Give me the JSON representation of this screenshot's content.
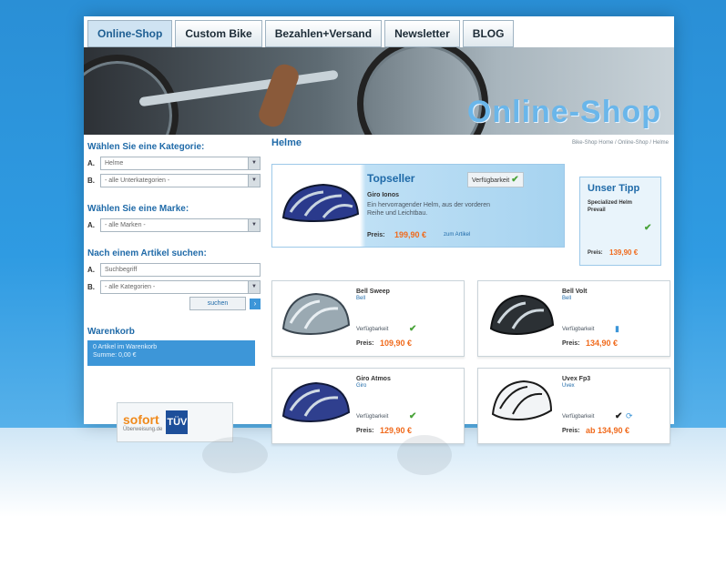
{
  "nav": {
    "tabs": [
      "Online-Shop",
      "Custom Bike",
      "Bezahlen+Versand",
      "Newsletter",
      "BLOG"
    ]
  },
  "header": {
    "tagline": "",
    "shop_title": "Online-Shop"
  },
  "sidebar": {
    "category": {
      "heading": "Wählen Sie eine Kategorie:",
      "rows": [
        {
          "label": "A.",
          "value": "Helme"
        },
        {
          "label": "B.",
          "value": "- alle Unterkategorien -"
        }
      ]
    },
    "brand": {
      "heading": "Wählen Sie eine Marke:",
      "rows": [
        {
          "label": "A.",
          "value": "- alle Marken -"
        }
      ]
    },
    "search": {
      "heading": "Nach einem Artikel suchen:",
      "rows": [
        {
          "label": "A.",
          "value": "Suchbegriff"
        },
        {
          "label": "B.",
          "value": "- alle Kategorien -"
        }
      ],
      "button": "suchen"
    },
    "cart": {
      "heading": "Warenkorb",
      "line1": "0 Artikel im Warenkorb",
      "line2": "Summe: 0,00 €"
    },
    "badges": {
      "sofort": "sofort",
      "sofort_sub": "Überweisung.de",
      "tuv": "TÜV"
    }
  },
  "main": {
    "page_title": "Helme",
    "breadcrumb": "Bike-Shop Home / Online-Shop / Helme",
    "hero": {
      "label": "Topseller",
      "availability": "Verfügbarkeit",
      "name": "Giro Ionos",
      "desc": "Ein hervorragender Helm, aus der vorderen Reihe und Leichtbau.",
      "price_label": "Preis:",
      "price": "199,90 €",
      "more": "zum Artikel"
    },
    "tip": {
      "label": "Unser Tipp",
      "name": "Specialized Helm Prevail",
      "price_label": "Preis:",
      "price": "139,90 €"
    },
    "products": [
      {
        "name": "Bell Sweep",
        "brand": "Bell",
        "avail": "Verfügbarkeit",
        "price_label": "Preis:",
        "price": "109,90 €"
      },
      {
        "name": "Bell Volt",
        "brand": "Bell",
        "avail": "Verfügbarkeit",
        "price_label": "Preis:",
        "price": "134,90 €"
      },
      {
        "name": "Giro Atmos",
        "brand": "Giro",
        "avail": "Verfügbarkeit",
        "price_label": "Preis:",
        "price": "129,90 €"
      },
      {
        "name": "Uvex Fp3",
        "brand": "Uvex",
        "avail": "Verfügbarkeit",
        "price_label": "Preis:",
        "price": "ab 134,90 €"
      }
    ]
  },
  "colors": {
    "accent": "#1f6aa8",
    "price": "#f06a1c",
    "background": "#2f9be2"
  }
}
